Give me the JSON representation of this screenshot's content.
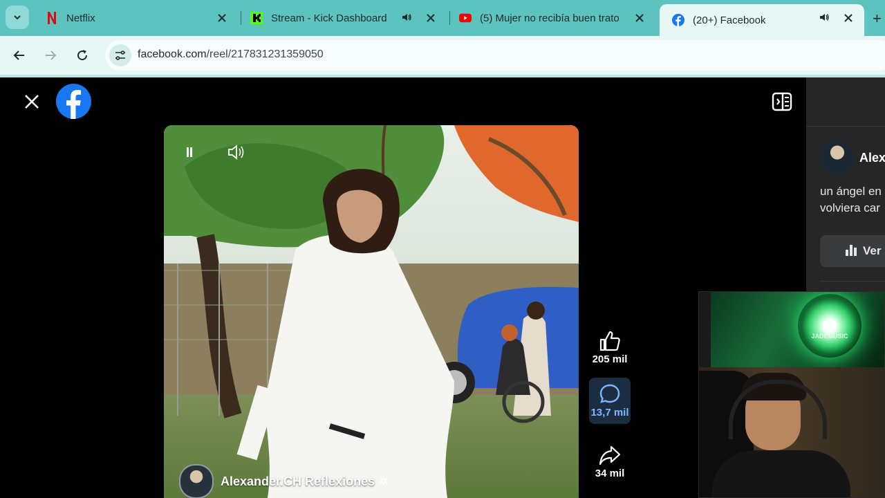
{
  "browser": {
    "tabs": [
      {
        "title": "Netflix",
        "favicon": "netflix-icon",
        "has_audio": false,
        "active": false
      },
      {
        "title": "Stream - Kick Dashboard",
        "favicon": "kick-icon",
        "has_audio": true,
        "active": false
      },
      {
        "title": "(5) Mujer no recibía buen trato",
        "favicon": "youtube-icon",
        "has_audio": false,
        "active": false
      },
      {
        "title": "(20+) Facebook",
        "favicon": "facebook-icon",
        "has_audio": true,
        "active": true
      }
    ],
    "new_tab_label": "+",
    "address": {
      "host": "facebook.com",
      "path": "/reel/217831231359050"
    }
  },
  "reel": {
    "channel_name": "Alexander.CH Reflexiones",
    "actions": {
      "likes": "205 mil",
      "comments": "13,7 mil",
      "shares": "34 mil"
    }
  },
  "side_panel": {
    "author_name": "Alex",
    "description_line1": "un ángel en",
    "description_line2": "volviera car",
    "button_label": "Ver"
  },
  "webcam": {
    "logo_text": "JADEMUSIC"
  },
  "colors": {
    "tab_strip": "#5cc3bf",
    "toolbar": "#e6f7f6",
    "facebook_blue": "#1877f2",
    "comment_highlight": "#7fb7ff"
  }
}
